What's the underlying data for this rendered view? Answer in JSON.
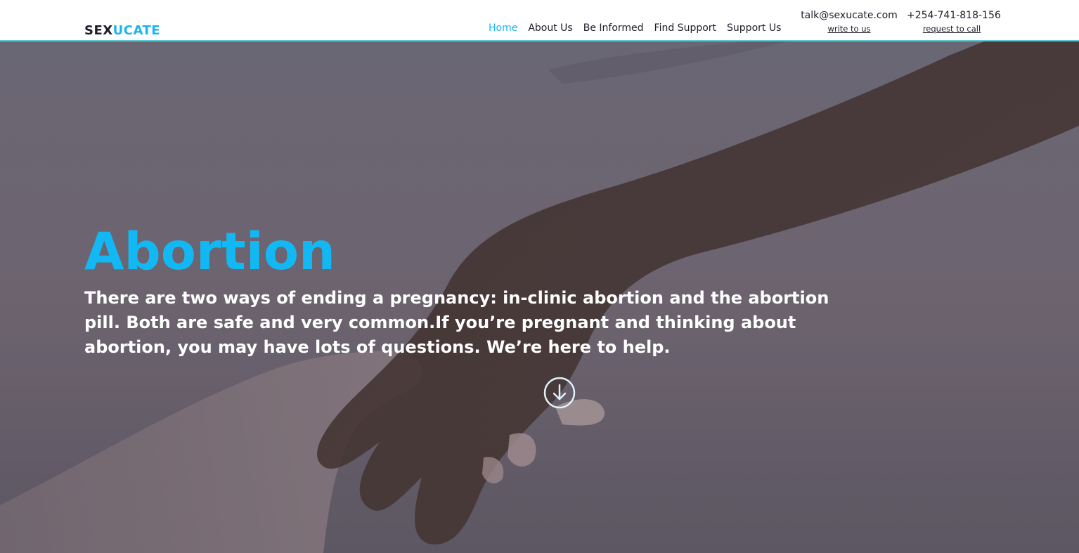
{
  "header": {
    "logo": {
      "part1": "SEX",
      "part2": "UCATE"
    },
    "nav": [
      {
        "label": "Home",
        "active": true
      },
      {
        "label": "About Us",
        "active": false
      },
      {
        "label": "Be Informed",
        "active": false
      },
      {
        "label": "Find Support",
        "active": false
      },
      {
        "label": "Support Us",
        "active": false
      }
    ],
    "contact_email": {
      "value": "talk@sexucate.com",
      "action": "write to us"
    },
    "contact_phone": {
      "value": "+254-741-818-156",
      "action": "request to call"
    }
  },
  "hero": {
    "title": "Abortion",
    "text": "There are two ways of ending a pregnancy: in-clinic abortion and the abortion pill. Both are safe and very common.If you’re pregnant and thinking about abortion, you may have lots of questions. We’re here to help.",
    "scroll_icon": "arrow-down-circle-icon"
  },
  "colors": {
    "accent": "#1ab5f0",
    "header_border": "#5ec8cf",
    "text_dark": "#1d1d2b",
    "hero_overlay": "#6a6470"
  }
}
